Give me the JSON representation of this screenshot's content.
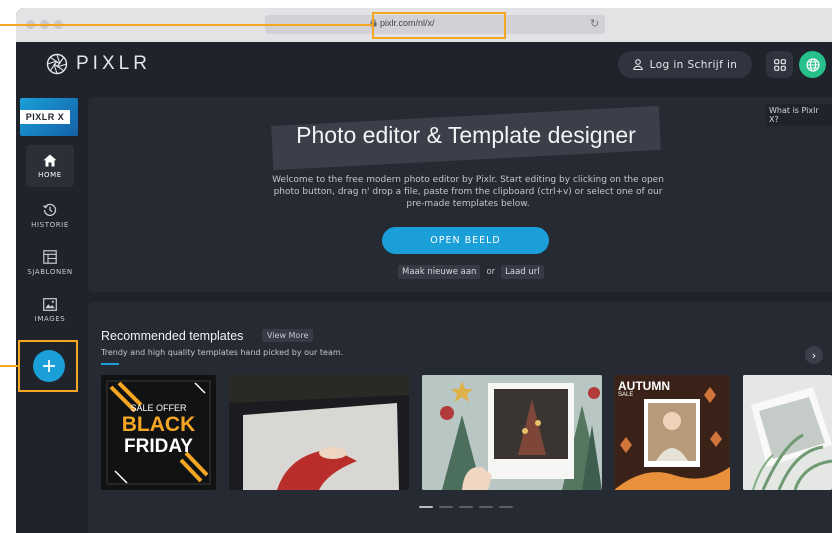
{
  "browser": {
    "url": "pixlr.com/nl/x/"
  },
  "header": {
    "logo_text": "PIXLR",
    "login_label": "Log in Schrijf in"
  },
  "sidebar": {
    "badge_text": "PIXLR X",
    "items": [
      {
        "label": "HOME",
        "icon": "home-icon",
        "active": true
      },
      {
        "label": "HISTORIE",
        "icon": "history-icon",
        "active": false
      },
      {
        "label": "SJABLONEN",
        "icon": "templates-icon",
        "active": false
      },
      {
        "label": "IMAGES",
        "icon": "image-icon",
        "active": false
      }
    ]
  },
  "hero": {
    "title": "Photo editor & Template designer",
    "description": "Welcome to the free modern photo editor by Pixlr. Start editing by clicking on the open photo button, drag n' drop a file, paste from the clipboard (ctrl+v) or select one of our pre-made templates below.",
    "open_button": "OPEN BEELD",
    "create_new": "Maak nieuwe aan",
    "or_text": "or",
    "load_url": "Laad url",
    "what_is": "What is Pixlr X?"
  },
  "templates": {
    "title": "Recommended templates",
    "view_more": "View More",
    "subtitle": "Trendy and high quality templates hand picked by our team.",
    "cards": [
      {
        "name": "black-friday",
        "text": [
          "SALE OFFER",
          "BLACK",
          "FRIDAY"
        ],
        "accent": "#f5a623"
      },
      {
        "name": "journal-photo",
        "text": []
      },
      {
        "name": "christmas-polaroid",
        "text": []
      },
      {
        "name": "autumn-sale",
        "text": [
          "AUTUMN",
          "SALE"
        ],
        "accent": "#f5a623"
      },
      {
        "name": "palm-polaroid",
        "text": []
      }
    ]
  },
  "colors": {
    "accent": "#1a9fd8",
    "annotation": "#f5a623",
    "background": "#1f232b",
    "panel": "#262a33",
    "green": "#27c08a"
  }
}
